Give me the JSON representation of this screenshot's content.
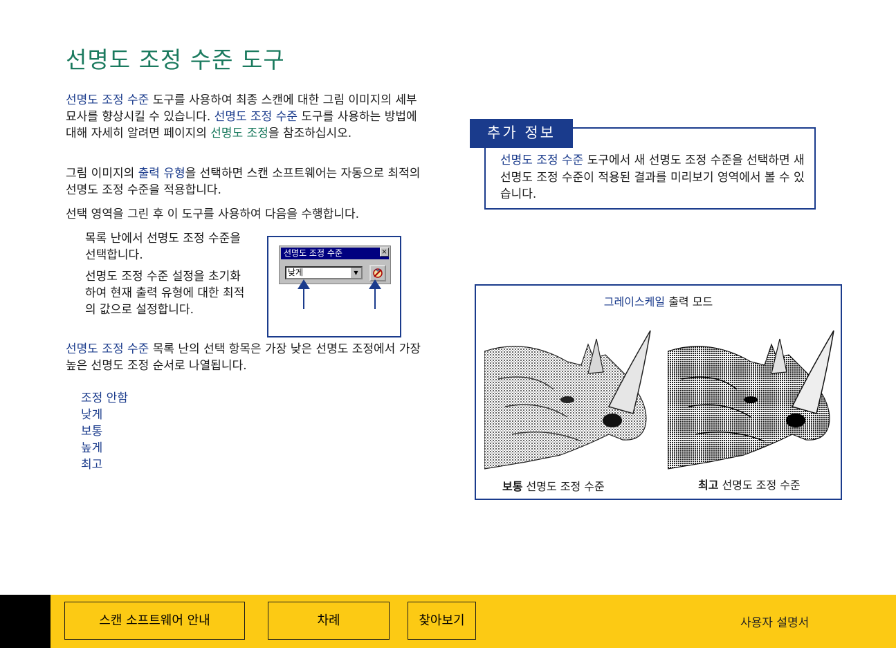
{
  "title": "선명도 조정 수준 도구",
  "para1": {
    "kw1": "선명도 조정 수준",
    "t1": " 도구를 사용하여  최종 스캔에 대한 그림 이미지의 세부 묘사를 향상시킬 수 있습니다. ",
    "kw2": "선명도 조정 수준",
    "t2": " 도구를 사용하는 방법에 대해 자세히 알려면     페이지의 ",
    "kw3": "선명도 조정",
    "t3": "을 참조하십시오."
  },
  "para2": {
    "t1": "그림 이미지의  ",
    "kw1": "출력 유형",
    "t2": "을 선택하면 스캔 소프트웨어는  자동으로 최적의 선명도 조정 수준을 적용합니다."
  },
  "para3": "선택 영역을 그린 후 이 도구를 사용하여  다음을 수행합니다.",
  "bullets": [
    "목록 난에서 선명도 조정 수준을 선택합니다.",
    "선명도 조정 수준 설정을 초기화하여 현재 출력 유형에 대한 최적의 값으로 설정합니다."
  ],
  "para4": {
    "kw1": "선명도 조정 수준",
    "t1": " 목록 난의 선택 항목은 가장 낮은 선명도  조정에서  가장 높은 선명도 조정 순서로 나열됩니다."
  },
  "levels": [
    "조정 안함",
    "낮게",
    "보통",
    "높게",
    "최고"
  ],
  "widget": {
    "title": "선명도 조정 수준",
    "close": "×",
    "selected": "낮게",
    "arrow": "▼"
  },
  "info": {
    "tab": "추가 정보",
    "kw1": "선명도 조정 수준",
    "t1": " 도구에서 새 선명도 조정 수준을 선택하면 새 선명도 조정 수준이 적용된 결과를 미리보기 영역에서 볼 수 있습니다."
  },
  "figure": {
    "title_kw": "그레이스케일",
    "title_rest": " 출력 모드",
    "cap_left_bold": "보통",
    "cap_left_rest": " 선명도 조정 수준",
    "cap_right_bold": "최고",
    "cap_right_rest": " 선명도 조정 수준"
  },
  "footer": {
    "btn1": "스캔 소프트웨어  안내",
    "btn2": "차례",
    "btn3": "찾아보기",
    "label": "사용자 설명서"
  }
}
